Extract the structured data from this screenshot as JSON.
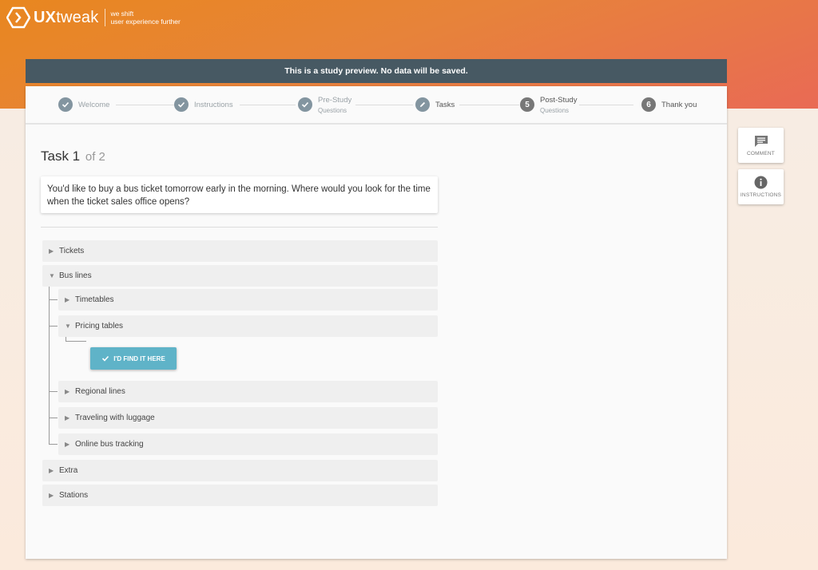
{
  "brand": {
    "logo_bold": "UX",
    "logo_thin": "tweak",
    "tagline_line1": "we shift",
    "tagline_line2": "user experience further"
  },
  "banner": {
    "text": "This is a study preview. No data will be saved."
  },
  "steps": [
    {
      "label": "Welcome",
      "sub": "",
      "state": "done"
    },
    {
      "label": "Instructions",
      "sub": "",
      "state": "done"
    },
    {
      "label": "Pre-Study",
      "sub": "Questions",
      "state": "done"
    },
    {
      "label": "Tasks",
      "sub": "",
      "state": "current"
    },
    {
      "label": "Post-Study",
      "sub": "Questions",
      "state": "upcoming",
      "number": "5"
    },
    {
      "label": "Thank you",
      "sub": "",
      "state": "upcoming",
      "number": "6"
    }
  ],
  "task": {
    "title": "Task 1",
    "of": "of 2",
    "description": "You'd like to buy a bus ticket tomorrow early in the morning. Where would you look for the time when the ticket sales office opens?"
  },
  "tree": {
    "tickets": "Tickets",
    "bus_lines": "Bus lines",
    "timetables": "Timetables",
    "pricing_tables": "Pricing tables",
    "regional_lines": "Regional lines",
    "traveling_with_luggage": "Traveling with luggage",
    "online_bus_tracking": "Online bus tracking",
    "extra": "Extra",
    "stations": "Stations"
  },
  "find_button": {
    "label": "I'D FIND IT HERE"
  },
  "side": {
    "comment_label": "COMMENT",
    "instructions_label": "INSTRUCTIONS"
  },
  "colors": {
    "accent_button": "#5fb3c8",
    "banner_bg": "#475963",
    "step_done": "#8395a0"
  }
}
